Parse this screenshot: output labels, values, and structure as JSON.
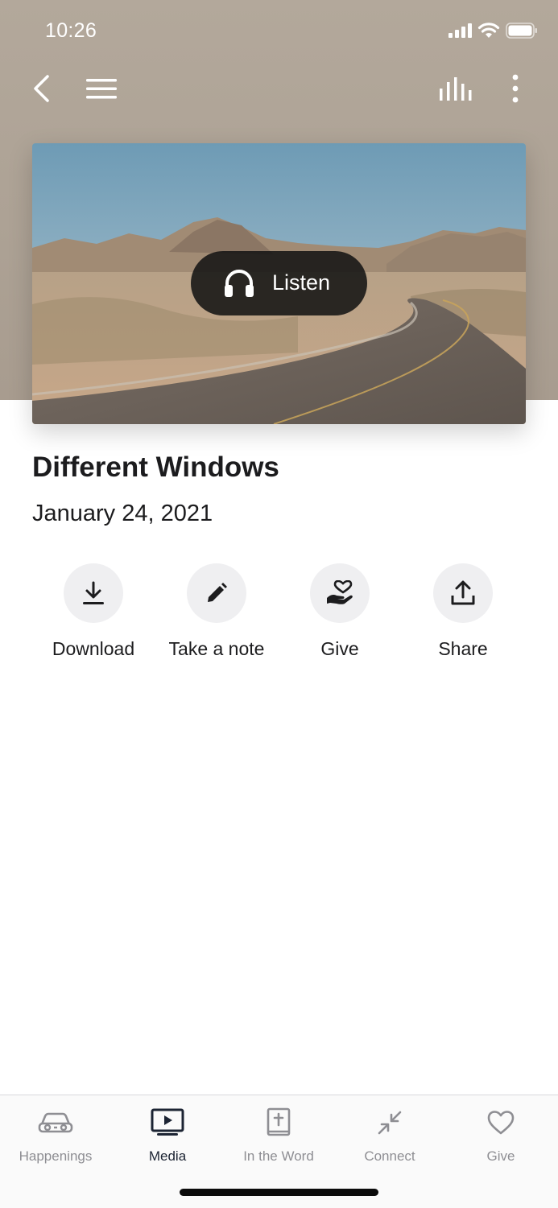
{
  "status_bar": {
    "time": "10:26"
  },
  "nav": {
    "back": "back-icon",
    "menu": "menu-icon",
    "audio": "audio-bars-icon",
    "more": "more-vertical-icon"
  },
  "media": {
    "listen_label": "Listen",
    "title": "Different Windows",
    "date": "January 24, 2021"
  },
  "actions": [
    {
      "label": "Download",
      "icon": "download-icon"
    },
    {
      "label": "Take a note",
      "icon": "pencil-icon"
    },
    {
      "label": "Give",
      "icon": "hand-heart-icon"
    },
    {
      "label": "Share",
      "icon": "share-icon"
    }
  ],
  "tabs": [
    {
      "label": "Happenings",
      "icon": "car-icon",
      "active": false
    },
    {
      "label": "Media",
      "icon": "tv-play-icon",
      "active": true
    },
    {
      "label": "In the Word",
      "icon": "bible-icon",
      "active": false
    },
    {
      "label": "Connect",
      "icon": "arrows-in-icon",
      "active": false
    },
    {
      "label": "Give",
      "icon": "heart-icon",
      "active": false
    }
  ],
  "colors": {
    "header_bg": "#ada295",
    "active_tab": "#1c2433",
    "inactive_tab": "#8e8e93",
    "action_circle": "#efeff1"
  }
}
